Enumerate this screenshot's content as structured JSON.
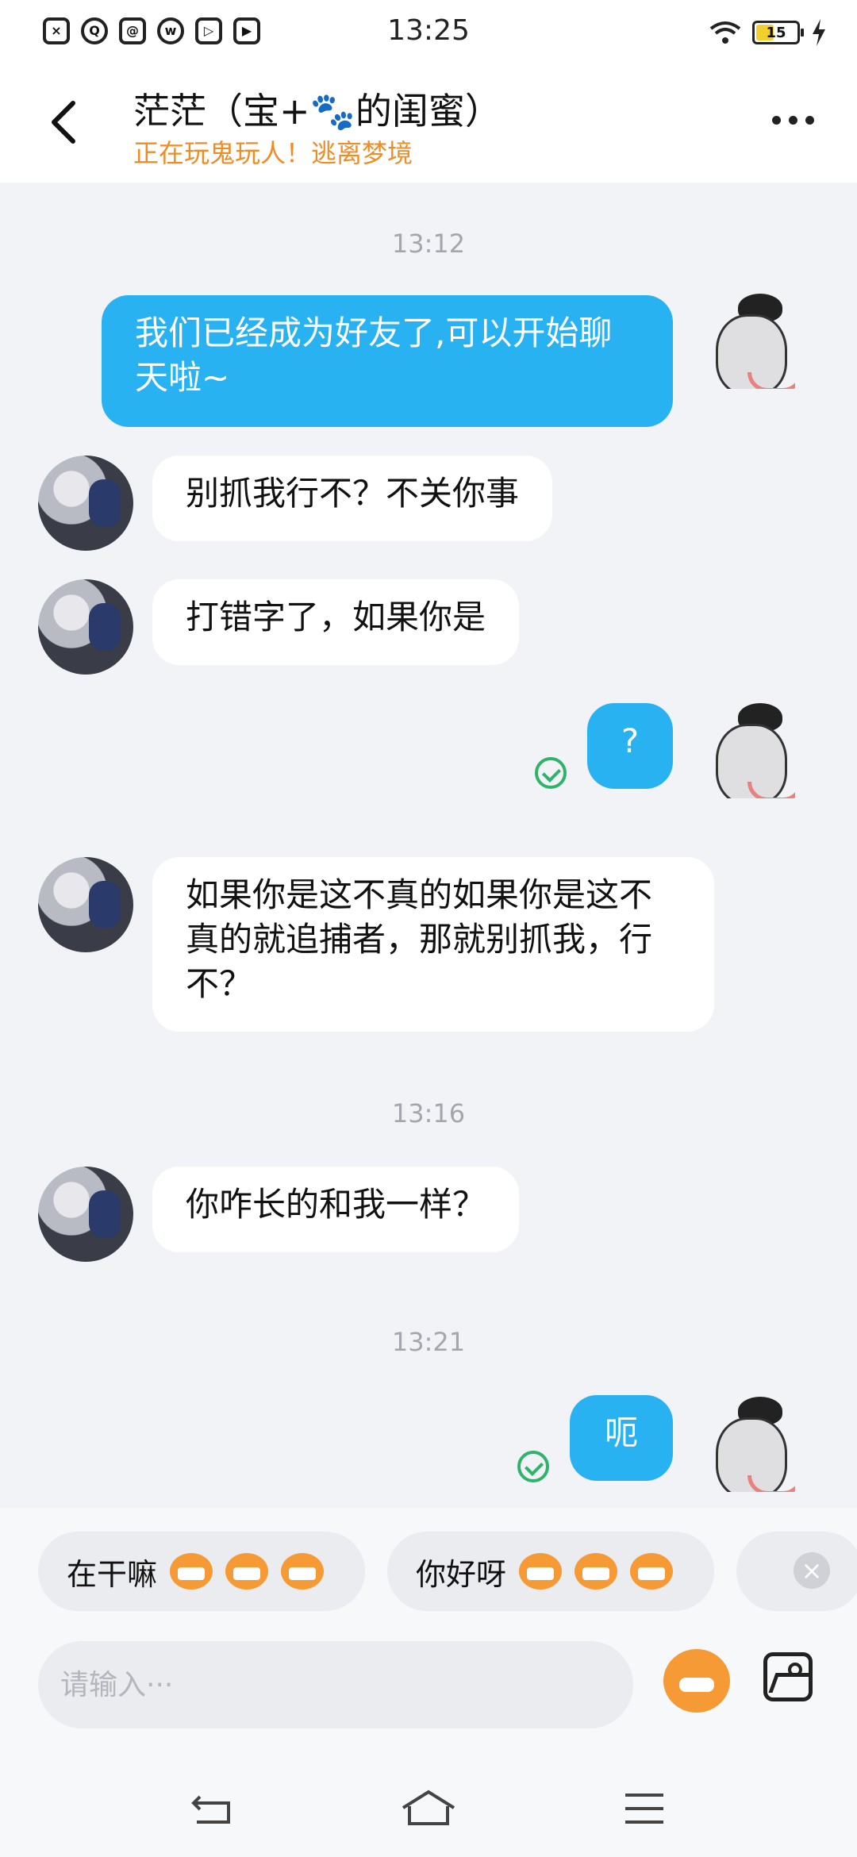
{
  "status_bar": {
    "time": "13:25",
    "battery": "15",
    "notification_icons": [
      "x-icon",
      "q-icon",
      "at-icon",
      "weibo-icon",
      "play-icon",
      "video-icon"
    ]
  },
  "header": {
    "title": "茫茫（宝+🐾的闺蜜）",
    "subtitle": "正在玩鬼玩人！逃离梦境"
  },
  "messages": [
    {
      "type": "time",
      "text": "13:12"
    },
    {
      "type": "out",
      "text": "我们已经成为好友了,可以开始聊天啦~"
    },
    {
      "type": "in",
      "text": "别抓我行不？不关你事"
    },
    {
      "type": "in",
      "text": "打错字了，如果你是"
    },
    {
      "type": "out",
      "text": "?"
    },
    {
      "type": "in",
      "text": "如果你是这不真的如果你是这不真的就追捕者，那就别抓我，行不？"
    },
    {
      "type": "time",
      "text": "13:16"
    },
    {
      "type": "in",
      "text": "你咋长的和我一样？"
    },
    {
      "type": "time",
      "text": "13:21"
    },
    {
      "type": "out",
      "text": "呃"
    }
  ],
  "quick_replies": [
    "在干嘛",
    "你好呀"
  ],
  "input": {
    "placeholder": "请输入···"
  },
  "colors": {
    "accent": "#29b2f2",
    "subtitle": "#f08c26",
    "read_check": "#2fb36a",
    "background": "#f2f3f7"
  }
}
